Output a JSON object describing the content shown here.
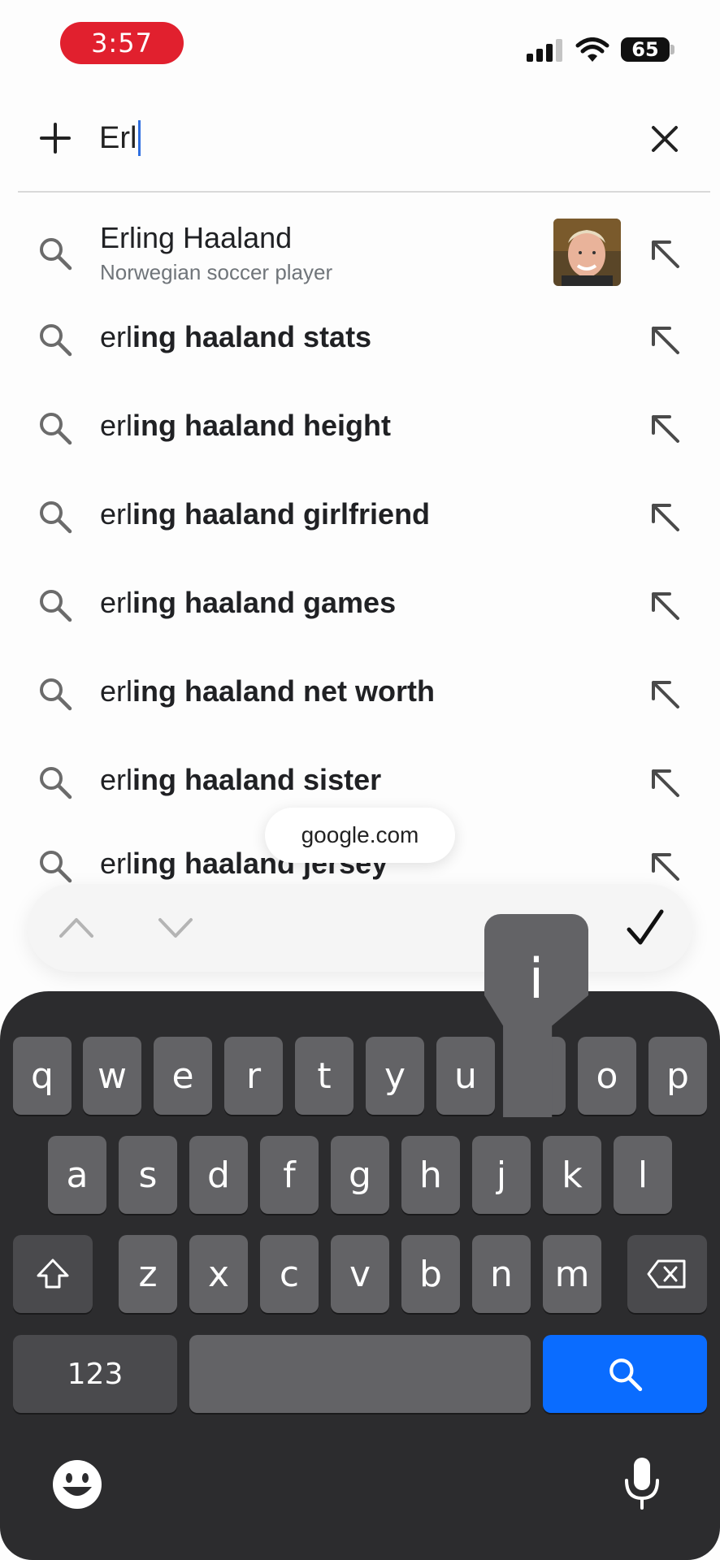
{
  "status_bar": {
    "time": "3:57",
    "battery": "65"
  },
  "search": {
    "query": "Erl"
  },
  "suggestions": [
    {
      "typed": "Erl",
      "rest": "ing Haaland",
      "subtitle": "Norwegian soccer player",
      "entity": true
    },
    {
      "typed": "erl",
      "rest": "ing haaland stats"
    },
    {
      "typed": "erl",
      "rest": "ing haaland height"
    },
    {
      "typed": "erl",
      "rest": "ing haaland girlfriend"
    },
    {
      "typed": "erl",
      "rest": "ing haaland games"
    },
    {
      "typed": "erl",
      "rest": "ing haaland net worth"
    },
    {
      "typed": "erl",
      "rest": "ing haaland sister"
    },
    {
      "typed": "erl",
      "rest": "ing haaland jersey"
    }
  ],
  "url_pill": "google.com",
  "keyboard": {
    "row1": [
      "q",
      "w",
      "e",
      "r",
      "t",
      "y",
      "u",
      "i",
      "o",
      "p"
    ],
    "row2": [
      "a",
      "s",
      "d",
      "f",
      "g",
      "h",
      "j",
      "k",
      "l"
    ],
    "row3": [
      "z",
      "x",
      "c",
      "v",
      "b",
      "n",
      "m"
    ],
    "numbers_label": "123",
    "pressed_key": "i"
  },
  "colors": {
    "accent": "#0a6cff",
    "time_pill": "#e1202e",
    "keyboard_bg": "#2c2c2e",
    "key": "#636366"
  }
}
